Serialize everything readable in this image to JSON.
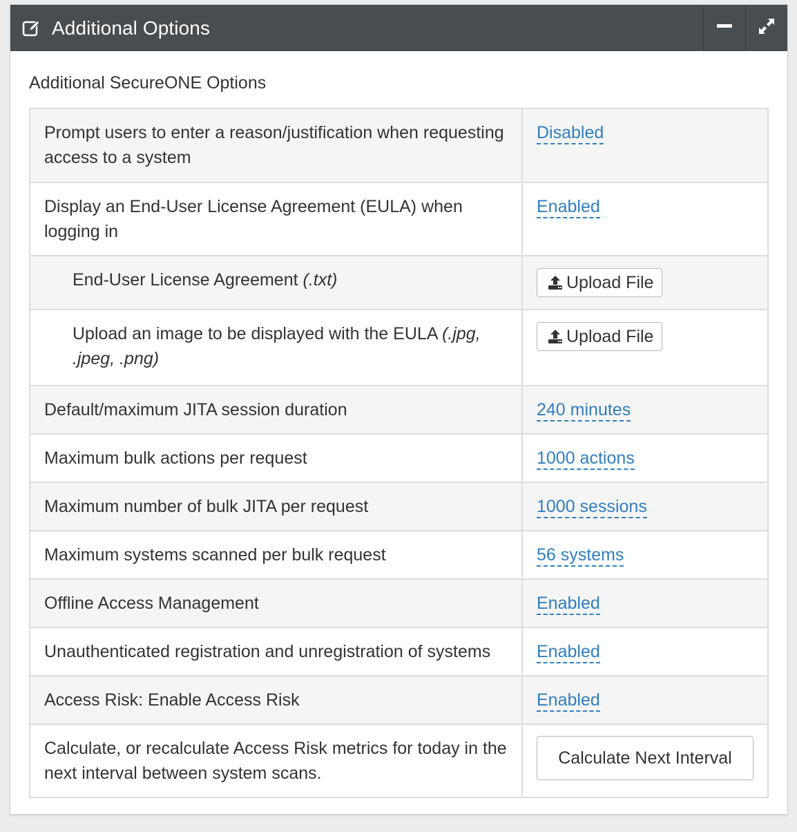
{
  "panel": {
    "title": "Additional Options",
    "subtitle": "Additional SecureONE Options"
  },
  "rows": [
    {
      "label": "Prompt users to enter a reason/justification when requesting access to a system",
      "value": "Disabled"
    },
    {
      "label": "Display an End-User License Agreement (EULA) when logging in",
      "value": "Enabled"
    },
    {
      "label": "End-User License Agreement",
      "label_ext": "(.txt)",
      "button": "Upload File"
    },
    {
      "label": "Upload an image to be displayed with the EULA",
      "label_ext": "(.jpg, .jpeg, .png)",
      "button": "Upload File"
    },
    {
      "label": "Default/maximum JITA session duration",
      "value": "240 minutes"
    },
    {
      "label": "Maximum bulk actions per request",
      "value": "1000 actions"
    },
    {
      "label": "Maximum number of bulk JITA per request",
      "value": "1000 sessions"
    },
    {
      "label": "Maximum systems scanned per bulk request",
      "value": "56 systems"
    },
    {
      "label": "Offline Access Management",
      "value": "Enabled"
    },
    {
      "label": "Unauthenticated registration and unregistration of systems",
      "value": "Enabled"
    },
    {
      "label": "Access Risk: Enable Access Risk",
      "value": "Enabled"
    },
    {
      "label": "Calculate, or recalculate Access Risk metrics for today in the next interval between system scans.",
      "button": "Calculate Next Interval"
    }
  ],
  "colors": {
    "header_bg": "#4a4d50",
    "link": "#2f7fc0",
    "row_shade": "#f5f5f5"
  },
  "icons": {
    "title": "edit-icon",
    "minimize": "minus-icon",
    "expand": "expand-icon",
    "upload": "upload-icon"
  }
}
